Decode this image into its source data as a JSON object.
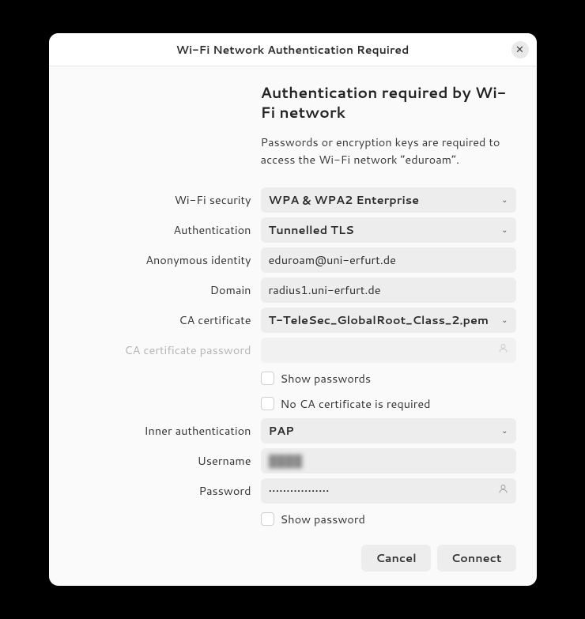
{
  "window": {
    "title": "Wi-Fi Network Authentication Required"
  },
  "header": {
    "heading": "Authentication required by Wi-Fi network",
    "subtext": "Passwords or encryption keys are required to access the Wi-Fi network “eduroam”."
  },
  "labels": {
    "wifi_security": "Wi-Fi security",
    "authentication": "Authentication",
    "anon_identity": "Anonymous identity",
    "domain": "Domain",
    "ca_cert": "CA certificate",
    "ca_cert_pw": "CA certificate password",
    "show_passwords": "Show passwords",
    "no_ca_cert": "No CA certificate is required",
    "inner_auth": "Inner authentication",
    "username": "Username",
    "password": "Password",
    "show_password": "Show password"
  },
  "values": {
    "wifi_security": "WPA & WPA2 Enterprise",
    "authentication": "Tunnelled TLS",
    "anon_identity": "eduroam@uni-erfurt.de",
    "domain": "radius1.uni-erfurt.de",
    "ca_cert": "T-TeleSec_GlobalRoot_Class_2.pem",
    "ca_cert_pw": "",
    "inner_auth": "PAP",
    "username": "████",
    "password": "•••••••••••••••••"
  },
  "buttons": {
    "cancel": "Cancel",
    "connect": "Connect"
  }
}
